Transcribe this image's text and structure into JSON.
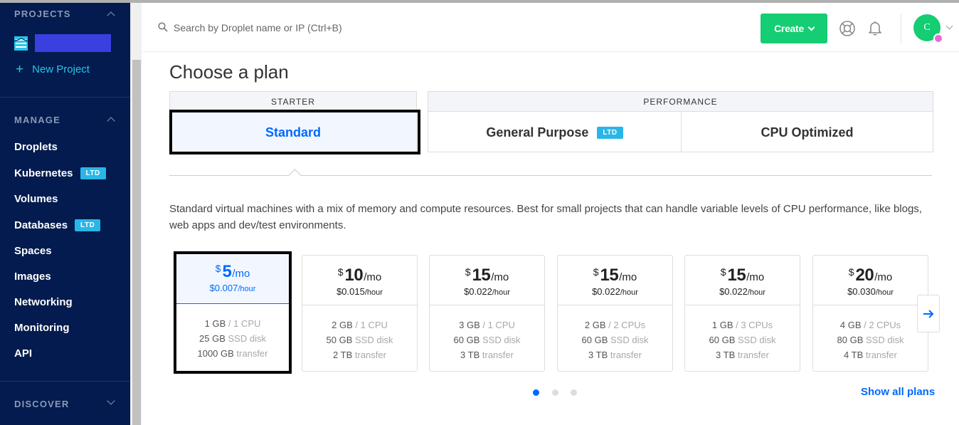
{
  "sidebar": {
    "projects_heading": "PROJECTS",
    "new_project_label": "New Project",
    "manage_heading": "MANAGE",
    "items": [
      {
        "label": "Droplets",
        "badge": ""
      },
      {
        "label": "Kubernetes",
        "badge": "LTD"
      },
      {
        "label": "Volumes",
        "badge": ""
      },
      {
        "label": "Databases",
        "badge": "LTD"
      },
      {
        "label": "Spaces",
        "badge": ""
      },
      {
        "label": "Images",
        "badge": ""
      },
      {
        "label": "Networking",
        "badge": ""
      },
      {
        "label": "Monitoring",
        "badge": ""
      },
      {
        "label": "API",
        "badge": ""
      }
    ],
    "discover_heading": "DISCOVER"
  },
  "topbar": {
    "search_placeholder": "Search by Droplet name or IP (Ctrl+B)",
    "create_label": "Create",
    "avatar_initial": "C"
  },
  "main": {
    "page_title": "Choose a plan",
    "groups": {
      "starter_label": "STARTER",
      "performance_label": "PERFORMANCE"
    },
    "tabs": {
      "standard": "Standard",
      "general_purpose": "General Purpose",
      "general_purpose_badge": "LTD",
      "cpu_optimized": "CPU Optimized"
    },
    "description": "Standard virtual machines with a mix of memory and compute resources. Best for small projects that can handle variable levels of CPU performance, like blogs, web apps and dev/test environments.",
    "plans": [
      {
        "currency": "$",
        "amount": "5",
        "per": "/mo",
        "hourly": "$0.007",
        "hour_unit": "/hour",
        "mem": "1 GB",
        "cpu": " / 1 CPU",
        "disk": "25 GB",
        "disk_unit": " SSD disk",
        "transfer": "1000 GB",
        "transfer_unit": " transfer"
      },
      {
        "currency": "$",
        "amount": "10",
        "per": "/mo",
        "hourly": "$0.015",
        "hour_unit": "/hour",
        "mem": "2 GB",
        "cpu": " / 1 CPU",
        "disk": "50 GB",
        "disk_unit": " SSD disk",
        "transfer": "2 TB",
        "transfer_unit": " transfer"
      },
      {
        "currency": "$",
        "amount": "15",
        "per": "/mo",
        "hourly": "$0.022",
        "hour_unit": "/hour",
        "mem": "3 GB",
        "cpu": " / 1 CPU",
        "disk": "60 GB",
        "disk_unit": " SSD disk",
        "transfer": "3 TB",
        "transfer_unit": " transfer"
      },
      {
        "currency": "$",
        "amount": "15",
        "per": "/mo",
        "hourly": "$0.022",
        "hour_unit": "/hour",
        "mem": "2 GB",
        "cpu": " / 2 CPUs",
        "disk": "60 GB",
        "disk_unit": " SSD disk",
        "transfer": "3 TB",
        "transfer_unit": " transfer"
      },
      {
        "currency": "$",
        "amount": "15",
        "per": "/mo",
        "hourly": "$0.022",
        "hour_unit": "/hour",
        "mem": "1 GB",
        "cpu": " / 3 CPUs",
        "disk": "60 GB",
        "disk_unit": " SSD disk",
        "transfer": "3 TB",
        "transfer_unit": " transfer"
      },
      {
        "currency": "$",
        "amount": "20",
        "per": "/mo",
        "hourly": "$0.030",
        "hour_unit": "/hour",
        "mem": "4 GB",
        "cpu": " / 2 CPUs",
        "disk": "80 GB",
        "disk_unit": " SSD disk",
        "transfer": "4 TB",
        "transfer_unit": " transfer"
      }
    ],
    "show_all_label": "Show all plans"
  },
  "colors": {
    "sidebar_bg": "#031b4e",
    "accent_blue": "#0069ff",
    "create_green": "#15cd72",
    "ltd_badge": "#29b6e6",
    "new_project_cyan": "#29c4e8"
  },
  "icons": [
    "search-icon",
    "lifebuoy-icon",
    "bell-icon",
    "chevron-down-icon",
    "arrow-right-icon",
    "plus-icon",
    "project-logo-icon"
  ]
}
